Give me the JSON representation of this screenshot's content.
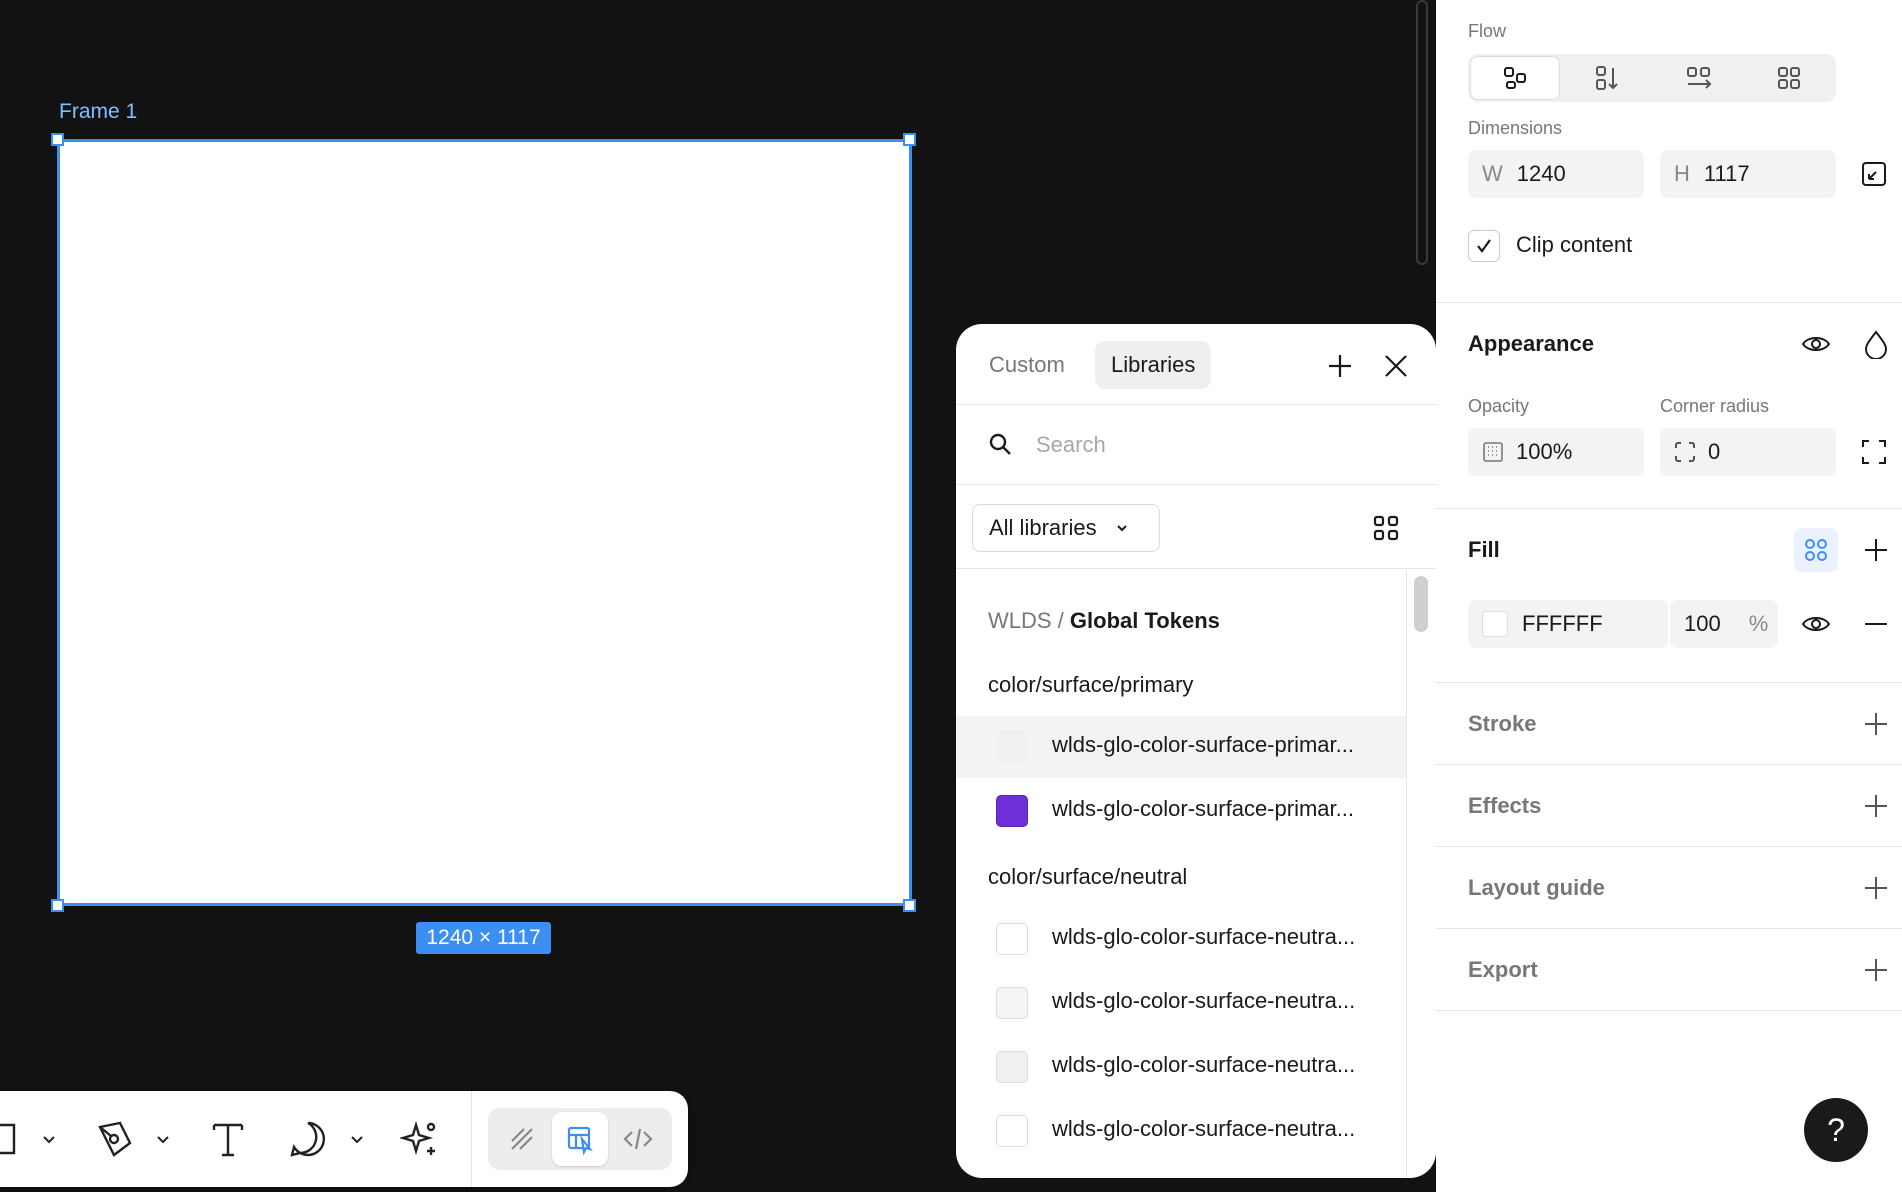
{
  "canvas": {
    "frame_label": "Frame 1",
    "dimension_badge": "1240 × 1117"
  },
  "toolbar": {
    "tools": [
      "frame-tool",
      "pen-tool",
      "text-tool",
      "comment-tool",
      "ai-tool"
    ],
    "modes": [
      "draw-mode",
      "design-mode",
      "dev-mode"
    ],
    "active_mode": "design-mode"
  },
  "library_panel": {
    "tabs": [
      "Custom",
      "Libraries"
    ],
    "active_tab": "Libraries",
    "search_placeholder": "Search",
    "library_filter": "All libraries",
    "breadcrumb_parent": "WLDS /",
    "breadcrumb_current": "Global Tokens",
    "groups": [
      {
        "title": "color/surface/primary",
        "tokens": [
          {
            "name": "wlds-glo-color-surface-primar...",
            "color": "#f0f0f0"
          },
          {
            "name": "wlds-glo-color-surface-primar...",
            "color": "#6d2fd9"
          }
        ]
      },
      {
        "title": "color/surface/neutral",
        "tokens": [
          {
            "name": "wlds-glo-color-surface-neutra...",
            "color": "#ffffff"
          },
          {
            "name": "wlds-glo-color-surface-neutra...",
            "color": "#f4f4f4"
          },
          {
            "name": "wlds-glo-color-surface-neutra...",
            "color": "#f0f0f0"
          },
          {
            "name": "wlds-glo-color-surface-neutra...",
            "color": "#ffffff"
          }
        ]
      }
    ]
  },
  "properties": {
    "flow_label": "Flow",
    "dimensions_label": "Dimensions",
    "width_prefix": "W",
    "width_value": "1240",
    "height_prefix": "H",
    "height_value": "1117",
    "clip_content_label": "Clip content",
    "clip_content_checked": true,
    "appearance_title": "Appearance",
    "opacity_label": "Opacity",
    "opacity_value": "100%",
    "corner_radius_label": "Corner radius",
    "corner_radius_value": "0",
    "fill_title": "Fill",
    "fill_hex": "FFFFFF",
    "fill_opacity": "100",
    "fill_opacity_unit": "%",
    "sections": [
      "Stroke",
      "Effects",
      "Layout guide",
      "Export"
    ],
    "help_label": "?"
  },
  "colors": {
    "accent": "#3c8ff2",
    "canvas_bg": "#121212"
  }
}
